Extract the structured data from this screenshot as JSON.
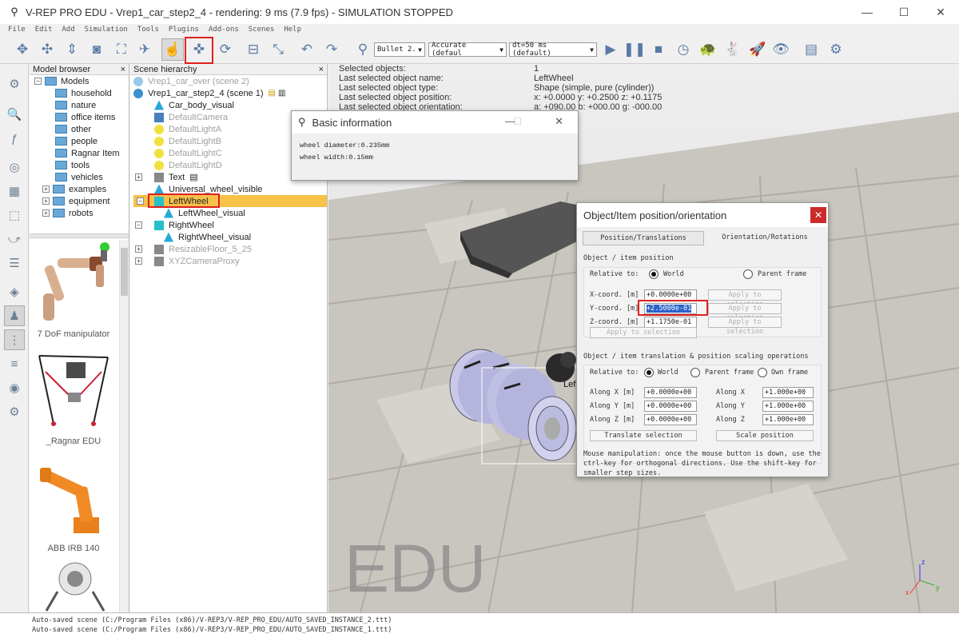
{
  "window": {
    "title": "V-REP PRO EDU - Vrep1_car_step2_4 - rendering: 9 ms (7.9 fps) - SIMULATION STOPPED",
    "minimize_glyph": "—",
    "maximize_glyph": "☐",
    "close_glyph": "✕"
  },
  "menu": [
    "File",
    "Edit",
    "Add",
    "Simulation",
    "Tools",
    "Plugins",
    "Add-ons",
    "Scenes",
    "Help"
  ],
  "toolbar": {
    "engine_select": "Bullet 2.",
    "accuracy_select": "Accurate (defaul",
    "timestep_select": "dt=50 ms (default)"
  },
  "model_browser": {
    "header": "Model browser",
    "close_glyph": "×",
    "root": "Models",
    "folders": [
      "household",
      "nature",
      "office items",
      "other",
      "people",
      "Ragnar Item",
      "tools",
      "vehicles",
      "examples",
      "equipment",
      "robots"
    ],
    "thumbnails": [
      {
        "caption": "7 DoF manipulator"
      },
      {
        "caption": "_Ragnar EDU"
      },
      {
        "caption": "ABB IRB 140"
      }
    ]
  },
  "scene_hierarchy": {
    "header": "Scene hierarchy",
    "close_glyph": "×",
    "other_scene": "Vrep1_car_over (scene 2)",
    "current_scene": "Vrep1_car_step2_4 (scene 1)",
    "objects": [
      {
        "name": "Car_body_visual",
        "dim": false,
        "icon": "shape"
      },
      {
        "name": "DefaultCamera",
        "dim": true,
        "icon": "camera"
      },
      {
        "name": "DefaultLightA",
        "dim": true,
        "icon": "light"
      },
      {
        "name": "DefaultLightB",
        "dim": true,
        "icon": "light"
      },
      {
        "name": "DefaultLightC",
        "dim": true,
        "icon": "light"
      },
      {
        "name": "DefaultLightD",
        "dim": true,
        "icon": "light"
      },
      {
        "name": "Text",
        "dim": false,
        "icon": "model"
      },
      {
        "name": "Universal_wheel_visible",
        "dim": false,
        "icon": "shape"
      },
      {
        "name": "LeftWheel",
        "dim": false,
        "icon": "cylinder",
        "selected": true
      },
      {
        "name": "LeftWheel_visual",
        "dim": false,
        "icon": "shape",
        "indent": 1
      },
      {
        "name": "RightWheel",
        "dim": false,
        "icon": "cylinder"
      },
      {
        "name": "RightWheel_visual",
        "dim": false,
        "icon": "shape",
        "indent": 1
      },
      {
        "name": "ResizableFloor_5_25",
        "dim": true,
        "icon": "model"
      },
      {
        "name": "XYZCameraProxy",
        "dim": true,
        "icon": "model"
      }
    ]
  },
  "selection_info": [
    {
      "key": "Selected objects:",
      "value": "1"
    },
    {
      "key": "Last selected object name:",
      "value": "LeftWheel"
    },
    {
      "key": "Last selected object type:",
      "value": "Shape (simple, pure (cylinder))"
    },
    {
      "key": "Last selected object position:",
      "value": "x: +0.0000    y: +0.2500    z: +0.1175"
    },
    {
      "key": "Last selected object orientation:",
      "value": "a: +090.00    b: +000.00    g: -000.00"
    }
  ],
  "basic_info": {
    "title": "Basic information",
    "lines": [
      "wheel diameter:0.235mm",
      "wheel width:0.15mm"
    ]
  },
  "pos_dialog": {
    "title": "Object/Item position/orientation",
    "tab_position": "Position/Translations",
    "tab_orientation": "Orientation/Rotations",
    "section1": "Object / item position",
    "relative_to": "Relative to:",
    "world": "World",
    "parent_frame": "Parent frame",
    "own_frame": "Own frame",
    "x_label": "X-coord. [m]",
    "y_label": "Y-coord. [m]",
    "z_label": "Z-coord. [m]",
    "x_value": "+0.0000e+00",
    "y_value": "+2.5000e-01",
    "z_value": "+1.1750e-01",
    "apply_selection": "Apply to selection",
    "section2": "Object / item translation & position scaling operations",
    "along_x": "Along X [m]",
    "along_y": "Along Y [m]",
    "along_z": "Along Z [m]",
    "trans_x": "+0.0000e+00",
    "trans_y": "+0.0000e+00",
    "trans_z": "+0.0000e+00",
    "scale_x_label": "Along X",
    "scale_y_label": "Along Y",
    "scale_z_label": "Along Z",
    "scale_x": "+1.000e+00",
    "scale_y": "+1.000e+00",
    "scale_z": "+1.000e+00",
    "translate_btn": "Translate selection",
    "scale_btn": "Scale position",
    "help1": "Mouse manipulation: once the mouse button is down, use the",
    "help2": "ctrl-key for orthogonal directions. Use the shift-key for",
    "help3": "smaller step sizes."
  },
  "viewport": {
    "watermark": "EDU",
    "wheel_label": "Left",
    "axes": {
      "z": "z",
      "y": "y",
      "x": "x"
    }
  },
  "status": [
    "Auto-saved scene (C:/Program Files (x86)/V-REP3/V-REP_PRO_EDU/AUTO_SAVED_INSTANCE_2.ttt)",
    "Auto-saved scene (C:/Program Files (x86)/V-REP3/V-REP_PRO_EDU/AUTO_SAVED_INSTANCE_1.ttt)"
  ],
  "colors": {
    "selection_bg": "#f7c14a",
    "highlight": "#e02020",
    "accent": "#5a7aa6"
  }
}
